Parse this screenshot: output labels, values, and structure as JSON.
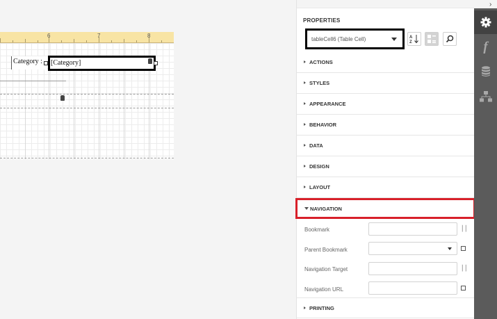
{
  "ruler": {
    "labels": [
      "6",
      "7",
      "8"
    ]
  },
  "report": {
    "label_text": "Category :",
    "cell_text": "[Category]"
  },
  "panel": {
    "title": "PROPERTIES",
    "selected_element": "tableCell6 (Table Cell)",
    "groups": [
      {
        "label": "ACTIONS",
        "expanded": false
      },
      {
        "label": "STYLES",
        "expanded": false
      },
      {
        "label": "APPEARANCE",
        "expanded": false
      },
      {
        "label": "BEHAVIOR",
        "expanded": false
      },
      {
        "label": "DATA",
        "expanded": false
      },
      {
        "label": "DESIGN",
        "expanded": false
      },
      {
        "label": "LAYOUT",
        "expanded": false
      },
      {
        "label": "NAVIGATION",
        "expanded": true
      },
      {
        "label": "PRINTING",
        "expanded": false
      }
    ],
    "navigation_props": [
      {
        "label": "Bookmark",
        "value": "",
        "kind": "text"
      },
      {
        "label": "Parent Bookmark",
        "value": "",
        "kind": "select"
      },
      {
        "label": "Navigation Target",
        "value": "",
        "kind": "text"
      },
      {
        "label": "Navigation URL",
        "value": "",
        "kind": "text"
      }
    ],
    "highlight_color": "#d8202a"
  },
  "tabs": {
    "icons": [
      "gear-icon",
      "function-icon",
      "database-icon",
      "hierarchy-icon"
    ],
    "function_glyph": "f",
    "active_index": 0
  },
  "colors": {
    "tabbar": "#5b5b5b",
    "ruler": "#f8e4a4"
  }
}
